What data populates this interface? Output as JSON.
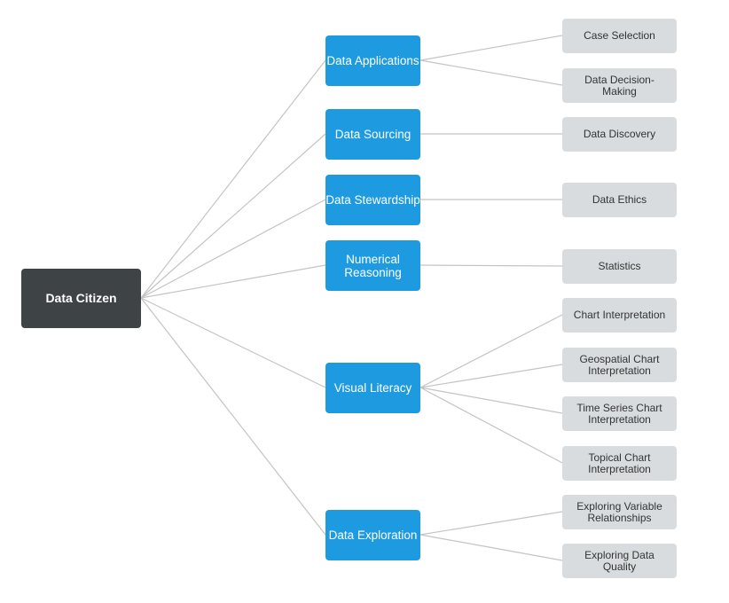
{
  "colors": {
    "root": "#3e4346",
    "branch": "#1e9be0",
    "leaf": "#d9dcdf",
    "connector": "#c4c4c4"
  },
  "root": {
    "label": "Data Citizen"
  },
  "branches": [
    {
      "label": "Data Applications",
      "children": [
        "Case Selection",
        "Data Decision-Making"
      ]
    },
    {
      "label": "Data Sourcing",
      "children": [
        "Data Discovery"
      ]
    },
    {
      "label": "Data Stewardship",
      "children": [
        "Data Ethics"
      ]
    },
    {
      "label": "Numerical Reasoning",
      "children": [
        "Statistics"
      ]
    },
    {
      "label": "Visual Literacy",
      "children": [
        "Chart Interpretation",
        "Geospatial Chart Interpretation",
        "Time Series Chart Interpretation",
        "Topical Chart Interpretation"
      ]
    },
    {
      "label": "Data Exploration",
      "children": [
        "Exploring Variable Relationships",
        "Exploring Data Quality"
      ]
    }
  ]
}
